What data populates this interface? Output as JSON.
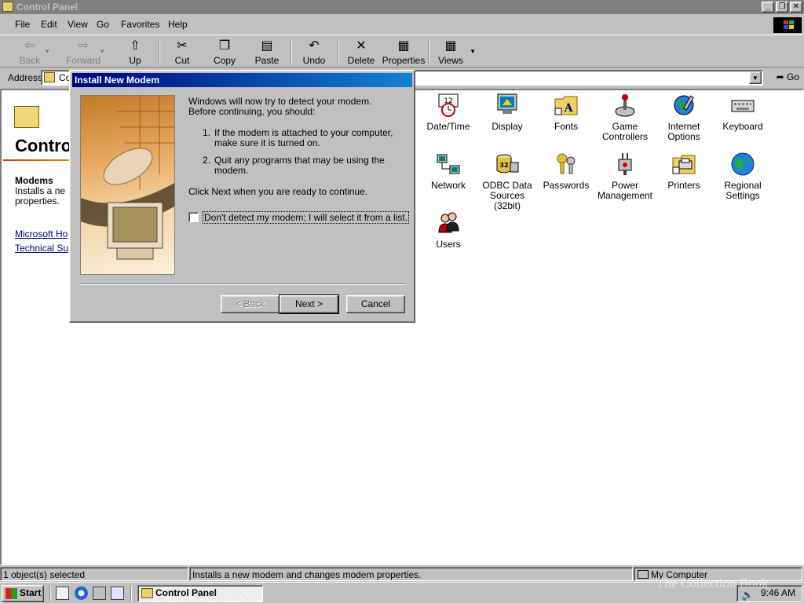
{
  "window": {
    "title": "Control Panel"
  },
  "menu": [
    "File",
    "Edit",
    "View",
    "Go",
    "Favorites",
    "Help"
  ],
  "toolbar": {
    "back": "Back",
    "forward": "Forward",
    "up": "Up",
    "cut": "Cut",
    "copy": "Copy",
    "paste": "Paste",
    "undo": "Undo",
    "delete": "Delete",
    "properties": "Properties",
    "views": "Views"
  },
  "address": {
    "label": "Address",
    "value": "Co",
    "go": "Go"
  },
  "webpanel": {
    "title": "Contro",
    "item_title": "Modems",
    "item_desc": "Installs a ne properties.",
    "link1": "Microsoft Ho",
    "link2": "Technical Su"
  },
  "icons": [
    {
      "label": "Date/Time",
      "icon": "clock-calendar-icon"
    },
    {
      "label": "Display",
      "icon": "monitor-icon"
    },
    {
      "label": "Fonts",
      "icon": "fonts-folder-icon"
    },
    {
      "label": "Game Controllers",
      "icon": "joystick-icon"
    },
    {
      "label": "Internet Options",
      "icon": "globe-tools-icon"
    },
    {
      "label": "Keyboard",
      "icon": "keyboard-icon"
    },
    {
      "label": "Network",
      "icon": "network-icon"
    },
    {
      "label": "ODBC Data Sources (32bit)",
      "icon": "database-icon"
    },
    {
      "label": "Passwords",
      "icon": "keys-icon"
    },
    {
      "label": "Power Management",
      "icon": "power-plug-icon"
    },
    {
      "label": "Printers",
      "icon": "printer-folder-icon"
    },
    {
      "label": "Regional Settings",
      "icon": "globe-icon"
    },
    {
      "label": "Users",
      "icon": "users-icon"
    }
  ],
  "dialog": {
    "title": "Install New Modem",
    "intro": "Windows will now try to detect your modem.  Before continuing, you should:",
    "step1_num": "1.",
    "step1": "If the modem is attached to your computer, make sure it is turned on.",
    "step2_num": "2.",
    "step2": "Quit any programs that may be using the modem.",
    "instruction": "Click Next when you are ready to continue.",
    "checkbox_label": "Don't detect my modem; I will select it from a list.",
    "checkbox_checked": false,
    "back_label": "< Back",
    "next_label": "Next >",
    "cancel_label": "Cancel"
  },
  "status": {
    "selected": "1 object(s) selected",
    "description": "Installs a new modem and changes modem properties.",
    "zone": "My Computer"
  },
  "taskbar": {
    "start": "Start",
    "task": "Control Panel",
    "clock": "9:46 AM"
  },
  "watermark": "The Collection Book",
  "colors": {
    "titlebar_active_start": "#000080",
    "titlebar_active_end": "#1084d0",
    "face": "#c0c0c0"
  }
}
